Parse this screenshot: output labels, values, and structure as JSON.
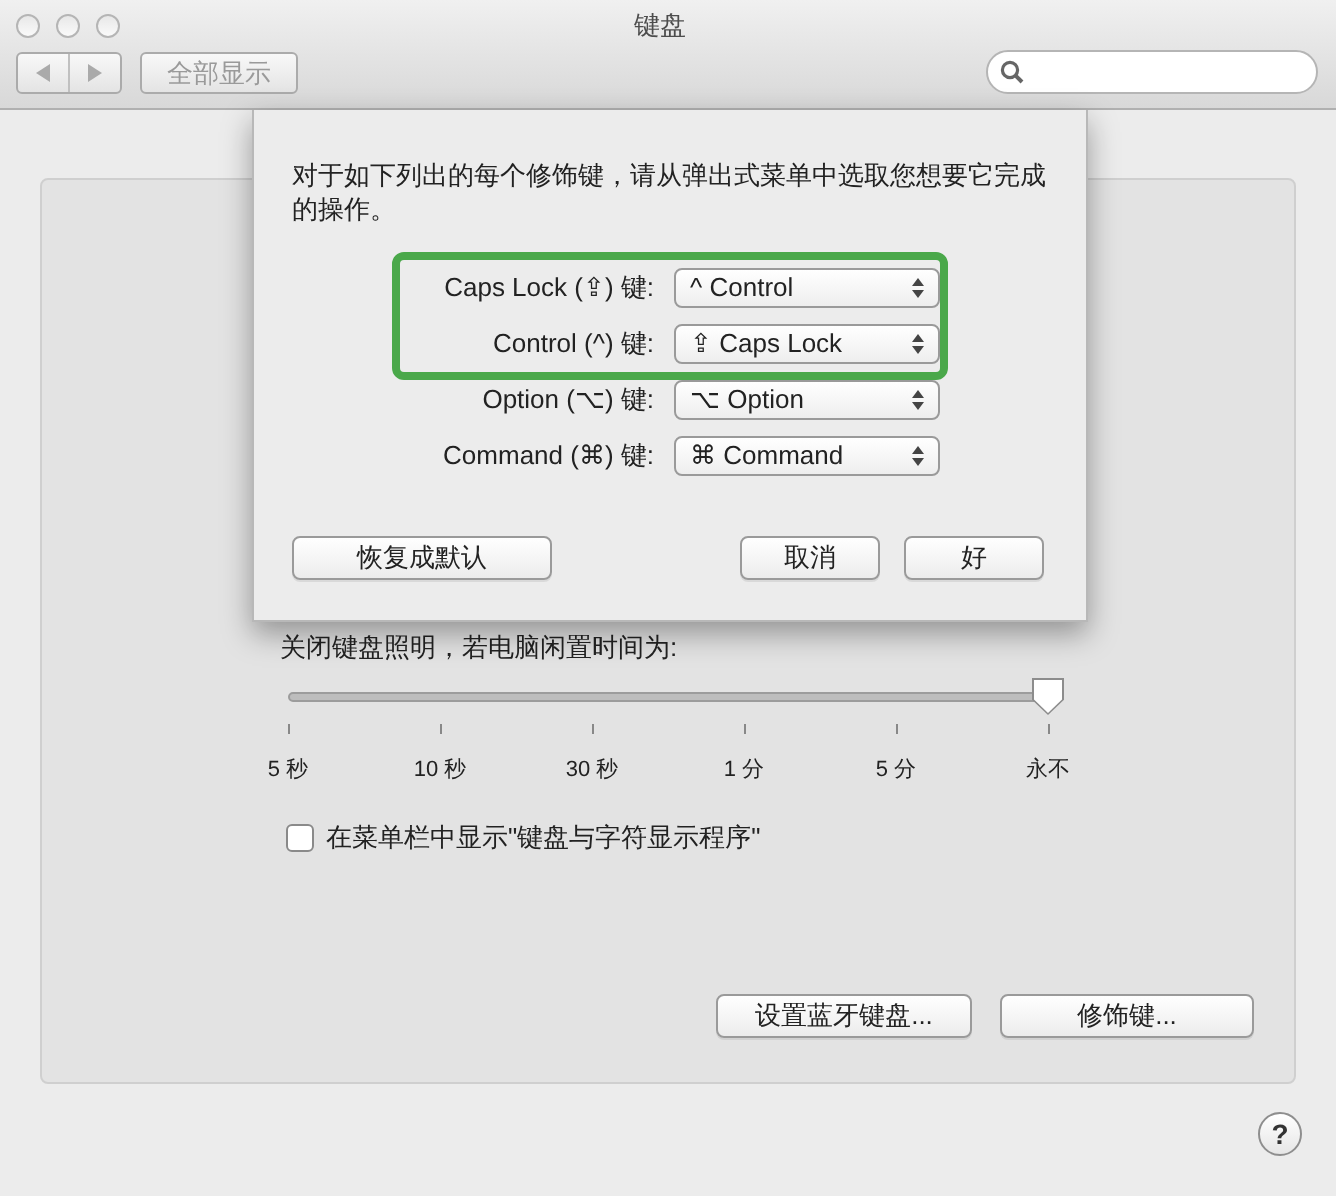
{
  "window": {
    "title": "键盘"
  },
  "toolbar": {
    "show_all": "全部显示"
  },
  "panel": {
    "slider": {
      "label": "关闭键盘照明，若电脑闲置时间为:",
      "level": 1,
      "ticks": [
        "5 秒",
        "10 秒",
        "30 秒",
        "1 分",
        "5 分",
        "永不"
      ]
    },
    "checkbox": {
      "label": "在菜单栏中显示\"键盘与字符显示程序\"",
      "checked": false
    },
    "buttons": [
      "设置蓝牙键盘...",
      "修饰键..."
    ]
  },
  "help": "?",
  "sheet": {
    "instructions": "对于如下列出的每个修饰键，请从弹出式菜单中选取您想要它完成的操作。",
    "modifiers": [
      {
        "label": "Caps Lock (⇪) 键:",
        "value": "^ Control",
        "highlighted": true
      },
      {
        "label": "Control (^) 键:",
        "value": "⇪ Caps Lock",
        "highlighted": true
      },
      {
        "label": "Option (⌥) 键:",
        "value": "⌥ Option",
        "highlighted": false
      },
      {
        "label": "Command (⌘) 键:",
        "value": "⌘ Command",
        "highlighted": false
      }
    ],
    "restore": "恢复成默认",
    "cancel": "取消",
    "ok": "好"
  }
}
